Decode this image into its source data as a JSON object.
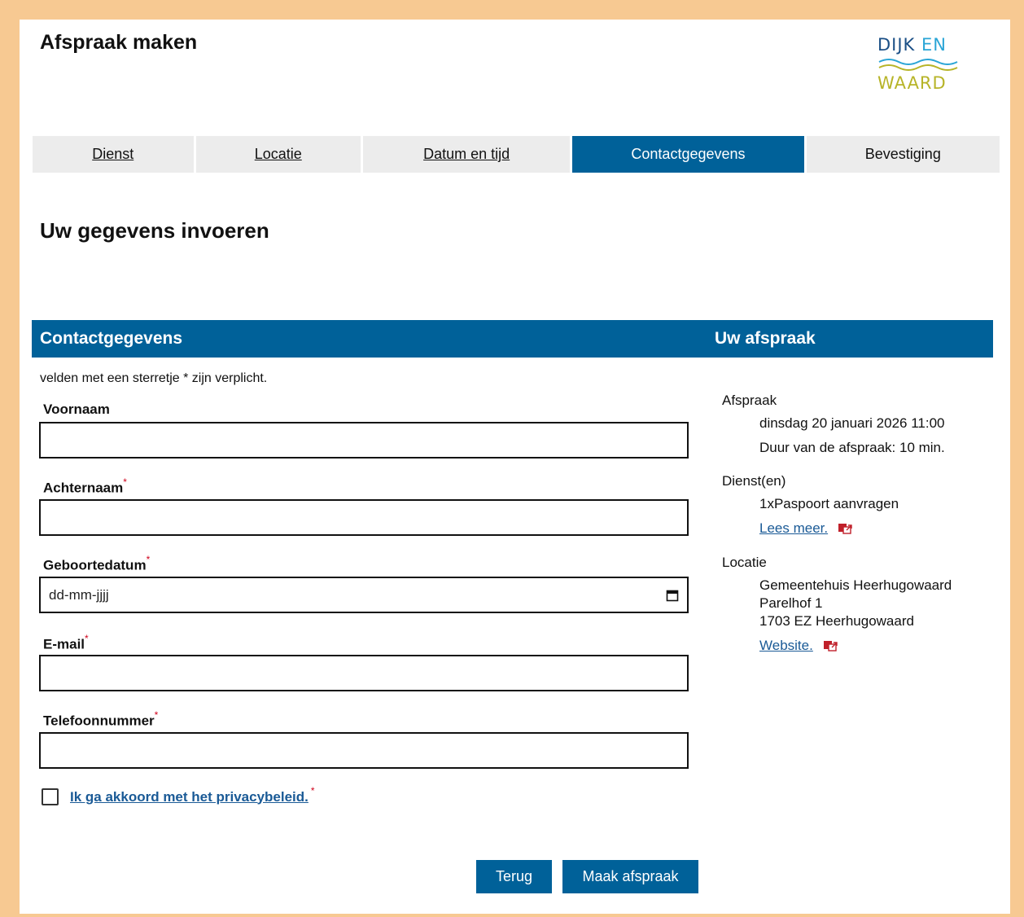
{
  "header": {
    "title": "Afspraak maken",
    "logo": {
      "line1a": "DIJK",
      "line1b": "EN",
      "line3": "WAARD"
    }
  },
  "steps": [
    {
      "label": "Dienst",
      "state": "link"
    },
    {
      "label": "Locatie",
      "state": "link"
    },
    {
      "label": "Datum en tijd",
      "state": "link"
    },
    {
      "label": "Contactgegevens",
      "state": "active"
    },
    {
      "label": "Bevestiging",
      "state": "pending"
    }
  ],
  "main": {
    "title": "Uw gegevens invoeren",
    "form_header": "Contactgegevens",
    "summary_header": "Uw afspraak",
    "required_note": "velden met een sterretje * zijn verplicht.",
    "fields": {
      "first_name": {
        "label": "Voornaam",
        "value": "",
        "required": false
      },
      "last_name": {
        "label": "Achternaam",
        "value": "",
        "required": true
      },
      "birth_date": {
        "label": "Geboortedatum",
        "placeholder": "dd-mm-jjjj",
        "required": true
      },
      "email": {
        "label": "E-mail",
        "value": "",
        "required": true
      },
      "phone": {
        "label": "Telefoonnummer",
        "value": "",
        "required": true
      }
    },
    "required_mark": "*",
    "consent": {
      "label": "Ik ga akkoord met het privacybeleid.",
      "checked": false
    },
    "buttons": {
      "back": "Terug",
      "submit": "Maak afspraak"
    }
  },
  "summary": {
    "appointment_label": "Afspraak",
    "appointment_datetime": "dinsdag 20 januari 2026 11:00",
    "duration": "Duur van de afspraak: 10 min.",
    "services_label": "Dienst(en)",
    "service": "1xPaspoort aanvragen",
    "read_more": "Lees meer.",
    "location_label": "Locatie",
    "location_name": "Gemeentehuis Heerhugowaard",
    "address_line1": "Parelhof 1",
    "address_line2": "1703 EZ Heerhugowaard",
    "website": "Website."
  },
  "colors": {
    "page_background": "#f7c992",
    "primary": "#006199",
    "tab_inactive": "#ececec",
    "link": "#1a5a96",
    "required": "#d0021b",
    "external_icon": "#c0202a"
  },
  "icons": [
    "calendar-icon",
    "external-link-icon",
    "wave-icon"
  ]
}
